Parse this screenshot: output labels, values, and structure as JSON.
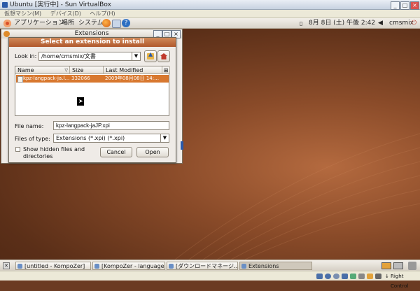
{
  "vbox": {
    "title": "Ubuntu [実行中] - Sun VirtualBox",
    "menu": [
      "仮想マシン(M)",
      "デバイス(D)",
      "ヘルプ(H)"
    ],
    "status_key": "Right Control"
  },
  "panel_top": {
    "menus": [
      "アプリケーション",
      "場所",
      "システム"
    ],
    "clock": "8月 8日 (土) 午後 2:42",
    "user": "cmsmix"
  },
  "extensions_window": {
    "title": "Extensions"
  },
  "dialog": {
    "title": "Select an extension to install",
    "look_in_label": "Look in:",
    "look_in_value": "/home/cmsmix/文書",
    "columns": [
      "Name",
      "Size",
      "Last Modified"
    ],
    "file": {
      "name": "kpz-langpack-ja.l…",
      "size": "332066",
      "modified": "2009年08月08日 14:…"
    },
    "file_name_label": "File name:",
    "file_name_value": "kpz-langpack-jaJP.xpi",
    "file_type_label": "Files of type:",
    "file_type_value": "Extensions (*.xpi) (*.xpi)",
    "show_hidden_label": "Show hidden files and directories",
    "cancel": "Cancel",
    "open": "Open"
  },
  "taskbar": {
    "tasks": [
      "[untitled - KompoZer]",
      "[KompoZer - language…",
      "[ダウンロードマネージ…",
      "Extensions"
    ]
  },
  "colors": {
    "selection": "#d8782f",
    "desktop": "#8a4b29"
  }
}
